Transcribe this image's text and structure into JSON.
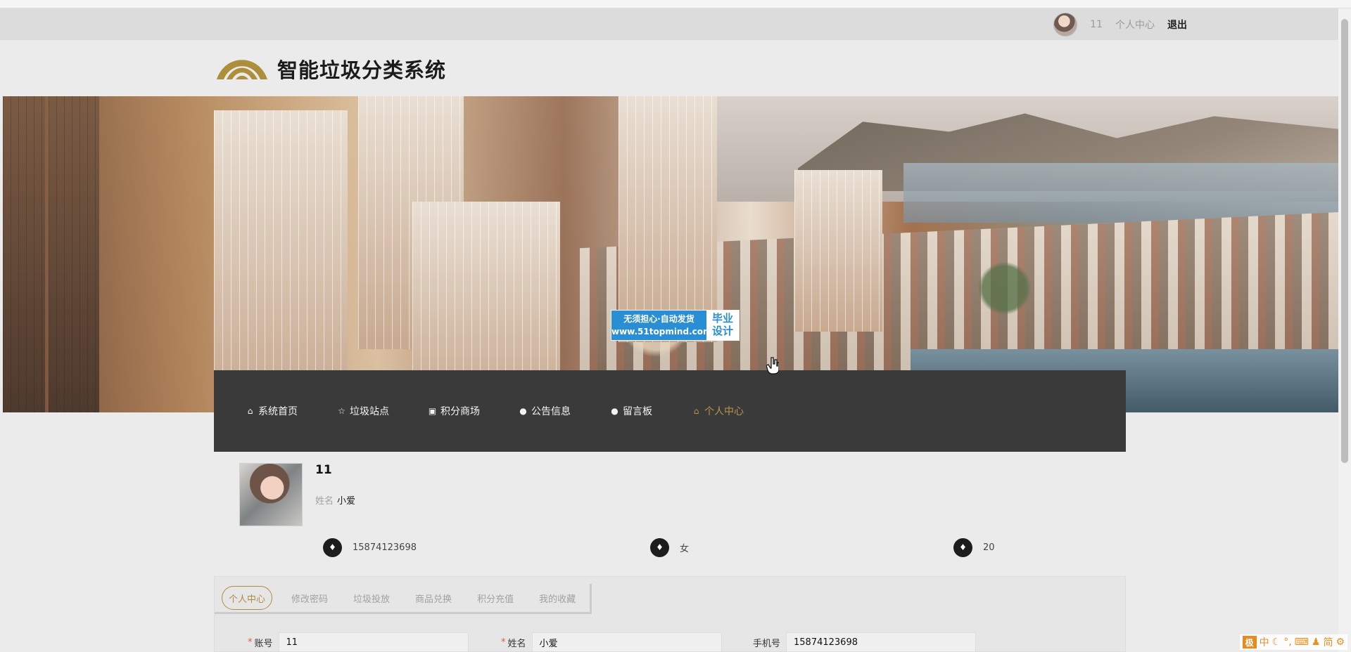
{
  "topbar": {
    "username": "11",
    "center_link": "个人中心",
    "logout": "退出"
  },
  "site": {
    "title": "智能垃圾分类系统"
  },
  "watermark": {
    "line1": "无须担心·自动发货",
    "line2": "www.51topmind.com",
    "right1": "毕业",
    "right2": "设计"
  },
  "nav": {
    "items": [
      {
        "label": "系统首页",
        "icon": "home-icon"
      },
      {
        "label": "垃圾站点",
        "icon": "star-icon"
      },
      {
        "label": "积分商场",
        "icon": "shopping-bag-icon"
      },
      {
        "label": "公告信息",
        "icon": "info-icon"
      },
      {
        "label": "留言板",
        "icon": "help-icon"
      },
      {
        "label": "个人中心",
        "icon": "home-icon",
        "active": true
      }
    ]
  },
  "profile": {
    "account": "11",
    "name_label": "姓名",
    "name": "小爱",
    "phone": "15874123698",
    "gender": "女",
    "points": "20"
  },
  "tabs": [
    {
      "label": "个人中心",
      "active": true
    },
    {
      "label": "修改密码"
    },
    {
      "label": "垃圾投放"
    },
    {
      "label": "商品兑换"
    },
    {
      "label": "积分充值"
    },
    {
      "label": "我的收藏"
    }
  ],
  "form": {
    "account_label": "账号",
    "account_value": "11",
    "name_label": "姓名",
    "name_value": "小爱",
    "phone_label": "手机号",
    "phone_value": "15874123698"
  },
  "ime": {
    "logo": "极",
    "mode": "中",
    "simplified": "简"
  }
}
